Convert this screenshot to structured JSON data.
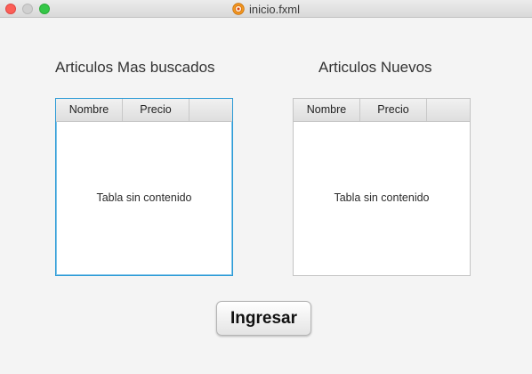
{
  "window": {
    "title": "inicio.fxml"
  },
  "left_panel": {
    "heading": "Articulos Mas buscados",
    "columns": [
      "Nombre",
      "Precio"
    ],
    "placeholder": "Tabla sin contenido"
  },
  "right_panel": {
    "heading": "Articulos Nuevos",
    "columns": [
      "Nombre",
      "Precio"
    ],
    "placeholder": "Tabla sin contenido"
  },
  "actions": {
    "enter_label": "Ingresar"
  },
  "colors": {
    "focus_border": "#2a9ad6",
    "close": "#fc5f57",
    "zoom": "#35c748"
  },
  "icons": {
    "app": "java-app-icon"
  }
}
